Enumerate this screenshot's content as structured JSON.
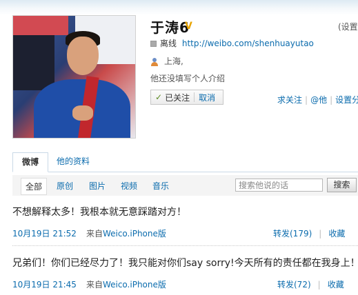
{
  "profile": {
    "name": "于涛6",
    "verified_mark": "V",
    "settings_link": "(设置",
    "status": "离线",
    "url": "http://weibo.com/shenhuayutao",
    "location": "上海,",
    "intro": "他还没填写个人介绍",
    "followed_label": "已关注",
    "cancel_label": "取消",
    "actions": [
      "求关注",
      "@他",
      "设置分"
    ]
  },
  "tabs": [
    {
      "label": "微博",
      "active": true
    },
    {
      "label": "他的资料",
      "active": false
    }
  ],
  "filters": [
    "全部",
    "原创",
    "图片",
    "视频",
    "音乐"
  ],
  "search": {
    "placeholder": "搜索他说的话",
    "button": "搜索"
  },
  "posts": [
    {
      "text": "不想解释太多！我根本就无意踩踏对方！",
      "time": "10月19日 21:52",
      "from_label": "来自",
      "source": "Weico.iPhone版",
      "repost": "转发(179)",
      "fav": "收藏"
    },
    {
      "text": "兄弟们！你们已经尽力了！我只能对你们say sorry!今天所有的责任都在我身上！",
      "time": "10月19日 21:45",
      "from_label": "来自",
      "source": "Weico.iPhone版",
      "repost": "转发(72)",
      "fav": "收藏"
    }
  ],
  "colors": {
    "link": "#0a6bad",
    "verified": "#e8a400"
  },
  "icons": [
    "verified-icon",
    "status-offline-icon",
    "person-icon",
    "check-icon"
  ]
}
